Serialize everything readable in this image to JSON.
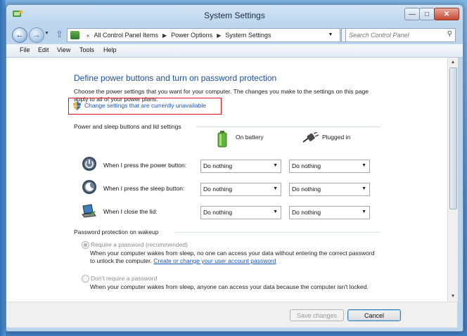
{
  "window": {
    "title": "System Settings"
  },
  "address": {
    "crumbs": [
      "All Control Panel Items",
      "Power Options",
      "System Settings"
    ],
    "search_placeholder": "Search Control Panel"
  },
  "menu": [
    "File",
    "Edit",
    "View",
    "Tools",
    "Help"
  ],
  "page": {
    "heading": "Define power buttons and turn on password protection",
    "intro": "Choose the power settings that you want for your computer. The changes you make to the settings on this page apply to all of your power plans.",
    "change_link": "Change settings that are currently unavailable"
  },
  "power_section": {
    "title": "Power and sleep buttons and lid settings",
    "col_battery": "On battery",
    "col_plugged": "Plugged in",
    "rows": [
      {
        "label": "When I press the power button:",
        "battery": "Do nothing",
        "plugged": "Do nothing"
      },
      {
        "label": "When I press the sleep button:",
        "battery": "Do nothing",
        "plugged": "Do nothing"
      },
      {
        "label": "When I close the lid:",
        "battery": "Do nothing",
        "plugged": "Do nothing"
      }
    ]
  },
  "password_section": {
    "title": "Password protection on wakeup",
    "require_label": "Require a password (recommended)",
    "require_desc": "When your computer wakes from sleep, no one can access your data without entering the correct password to unlock the computer.",
    "require_link": "Create or change your user account password",
    "norequire_label": "Don't require a password",
    "norequire_desc": "When your computer wakes from sleep, anyone can access your data because the computer isn't locked."
  },
  "footer": {
    "save": "Save changes",
    "cancel": "Cancel"
  }
}
